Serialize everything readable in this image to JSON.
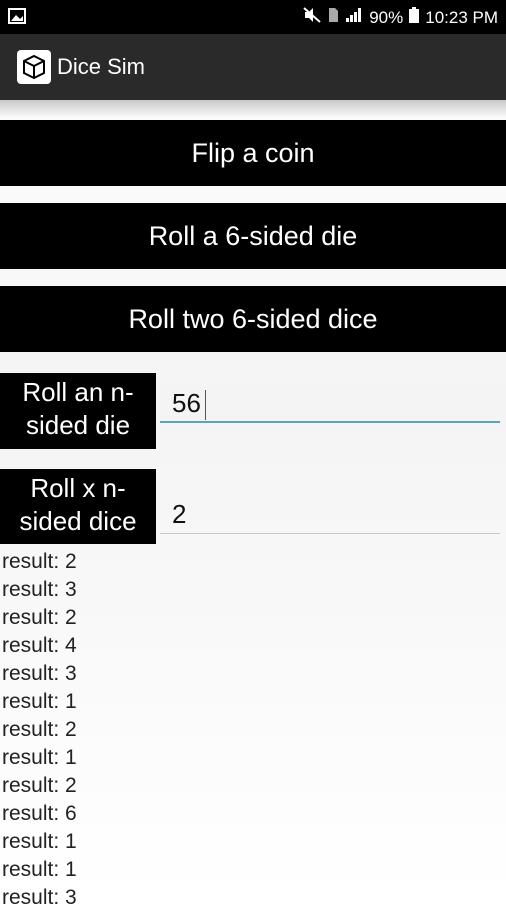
{
  "status": {
    "battery": "90%",
    "time": "10:23 PM"
  },
  "app": {
    "title": "Dice Sim"
  },
  "buttons": {
    "flip_coin": "Flip a coin",
    "roll_one": "Roll a 6-sided die",
    "roll_two": "Roll two 6-sided dice"
  },
  "inputs": {
    "n_sided": {
      "label_line1": "Roll an n-",
      "label_line2": "sided die",
      "value": "56"
    },
    "x_n_sided": {
      "label_line1": "Roll x n-",
      "label_line2": "sided dice",
      "value": "2"
    }
  },
  "results": [
    "result: 2",
    "result: 3",
    "result: 2",
    "result: 4",
    "result: 3",
    "result: 1",
    "result: 2",
    "result: 1",
    "result: 2",
    "result: 6",
    "result: 1",
    "result: 1",
    "result: 3"
  ]
}
